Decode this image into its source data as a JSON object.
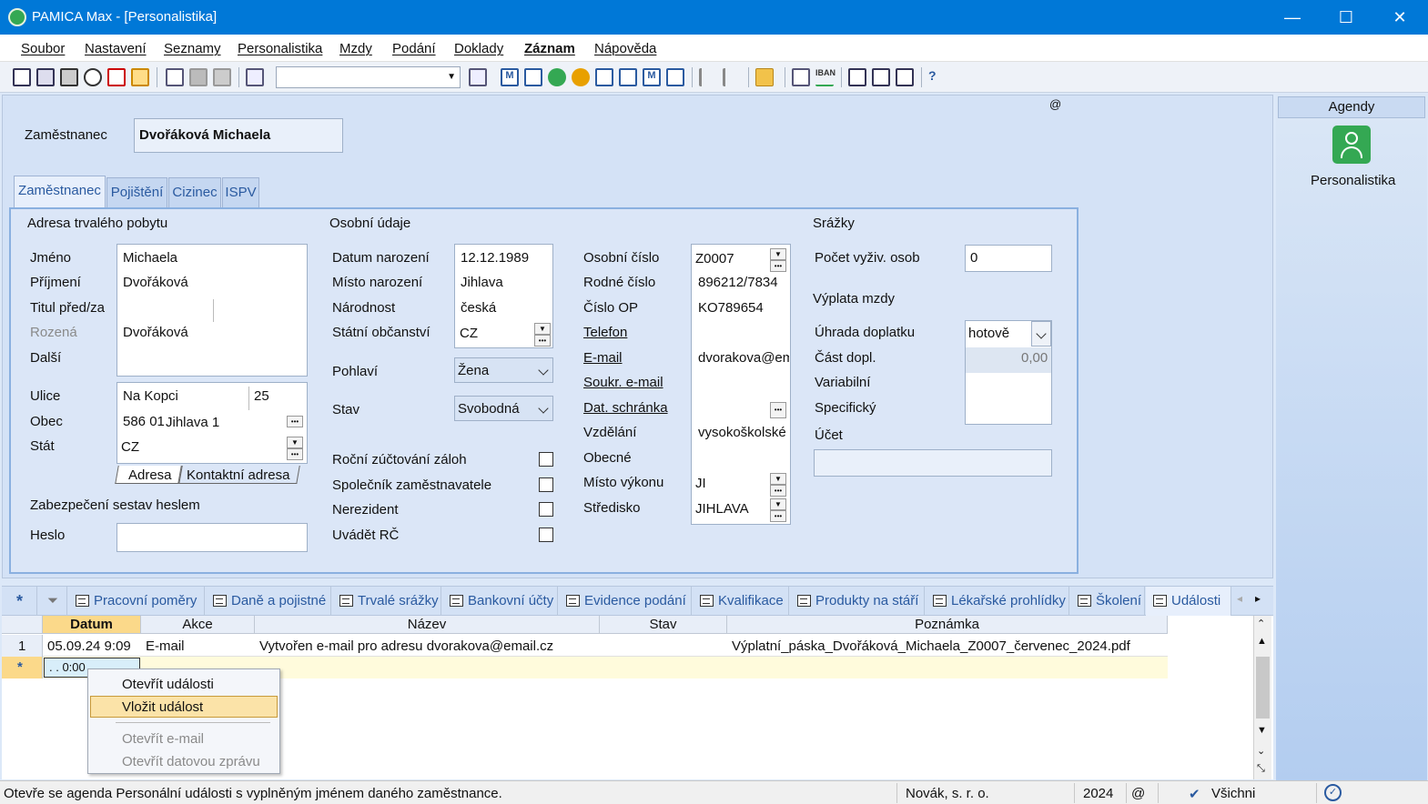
{
  "window": {
    "title": "PAMICA Max - [Personalistika]",
    "minimize": "—",
    "maximize": "☐",
    "close": "✕"
  },
  "menu": [
    "Soubor",
    "Nastavení",
    "Seznamy",
    "Personalistika",
    "Mzdy",
    "Podání",
    "Doklady",
    "Záznam",
    "Nápověda"
  ],
  "header": {
    "employee_label": "Zaměstnanec",
    "employee_name": "Dvořáková Michaela",
    "at": "@"
  },
  "tabs": [
    "Zaměstnanec",
    "Pojištění",
    "Cizinec",
    "ISPV"
  ],
  "address": {
    "section": "Adresa trvalého pobytu",
    "labels": {
      "first": "Jméno",
      "last": "Příjmení",
      "title": "Titul před/za",
      "born": "Rozená",
      "other": "Další",
      "street": "Ulice",
      "city": "Obec",
      "country": "Stát"
    },
    "first": "Michaela",
    "last": "Dvořáková",
    "born": "Dvořáková",
    "street": "Na Kopci",
    "number": "25",
    "zip": "586 01",
    "city": "Jihlava 1",
    "country": "CZ",
    "subtabs": [
      "Adresa",
      "Kontaktní adresa"
    ]
  },
  "security": {
    "section": "Zabezpečení sestav heslem",
    "password_label": "Heslo"
  },
  "personal": {
    "section": "Osobní údaje",
    "labels": {
      "birthdate": "Datum narození",
      "birthplace": "Místo narození",
      "nationality": "Národnost",
      "citizenship": "Státní občanství",
      "gender": "Pohlaví",
      "status": "Stav"
    },
    "birthdate": "12.12.1989",
    "birthplace": "Jihlava",
    "nationality": "česká",
    "citizenship": "CZ",
    "gender": "Žena",
    "status": "Svobodná",
    "checks": [
      "Roční zúčtování záloh",
      "Společník zaměstnavatele",
      "Nerezident",
      "Uvádět RČ"
    ]
  },
  "ids": {
    "labels": {
      "personal_no": "Osobní číslo",
      "birth_no": "Rodné číslo",
      "op": "Číslo OP",
      "phone": "Telefon",
      "email": "E-mail",
      "private_email": "Soukr. e-mail",
      "databox": "Dat. schránka",
      "education": "Vzdělání",
      "municipality": "Obecné",
      "workplace": "Místo výkonu",
      "center": "Středisko"
    },
    "personal_no": "Z0007",
    "birth_no": "896212/7834",
    "op": "KO789654",
    "email": "dvorakova@em",
    "education": "vysokoškolské",
    "workplace": "JI",
    "center": "JIHLAVA"
  },
  "deductions": {
    "section": "Srážky",
    "dependents_label": "Počet vyživ. osob",
    "dependents": "0",
    "payout_section": "Výplata mzdy",
    "labels": {
      "payment": "Úhrada doplatku",
      "part": "Část dopl.",
      "variable": "Variabilní",
      "specific": "Specifický",
      "account": "Účet"
    },
    "payment": "hotově",
    "part": "0,00"
  },
  "agendy": {
    "header": "Agendy",
    "item": "Personalistika"
  },
  "bottom_tabs": [
    "Pracovní poměry",
    "Daně a pojistné",
    "Trvalé srážky",
    "Bankovní účty",
    "Evidence podání",
    "Kvalifikace",
    "Produkty na stáří",
    "Lékařské prohlídky",
    "Školení",
    "Události"
  ],
  "grid": {
    "columns": [
      "Datum",
      "Akce",
      "Název",
      "Stav",
      "Poznámka"
    ],
    "rows": [
      {
        "n": "1",
        "date": "05.09.24 9:09",
        "action": "E-mail",
        "name": "Vytvořen e-mail pro adresu dvorakova@email.cz",
        "state": "",
        "note": "Výplatní_páska_Dvořáková_Michaela_Z0007_červenec_2024.pdf"
      }
    ],
    "new_row_marker": "*",
    "new_row_date": ". .   0:00"
  },
  "context_menu": [
    "Otevřít události",
    "Vložit událost",
    "Otevřít e-mail",
    "Otevřít datovou zprávu"
  ],
  "status": {
    "message": "Otevře se agenda Personální události s vyplněným jménem daného zaměstnance.",
    "company": "Novák, s. r. o.",
    "year": "2024",
    "at": "@",
    "user": "Všichni"
  },
  "colors": {
    "titlebar": "#0078d7",
    "accent_green": "#34a853",
    "highlight": "#fbe3a8"
  }
}
